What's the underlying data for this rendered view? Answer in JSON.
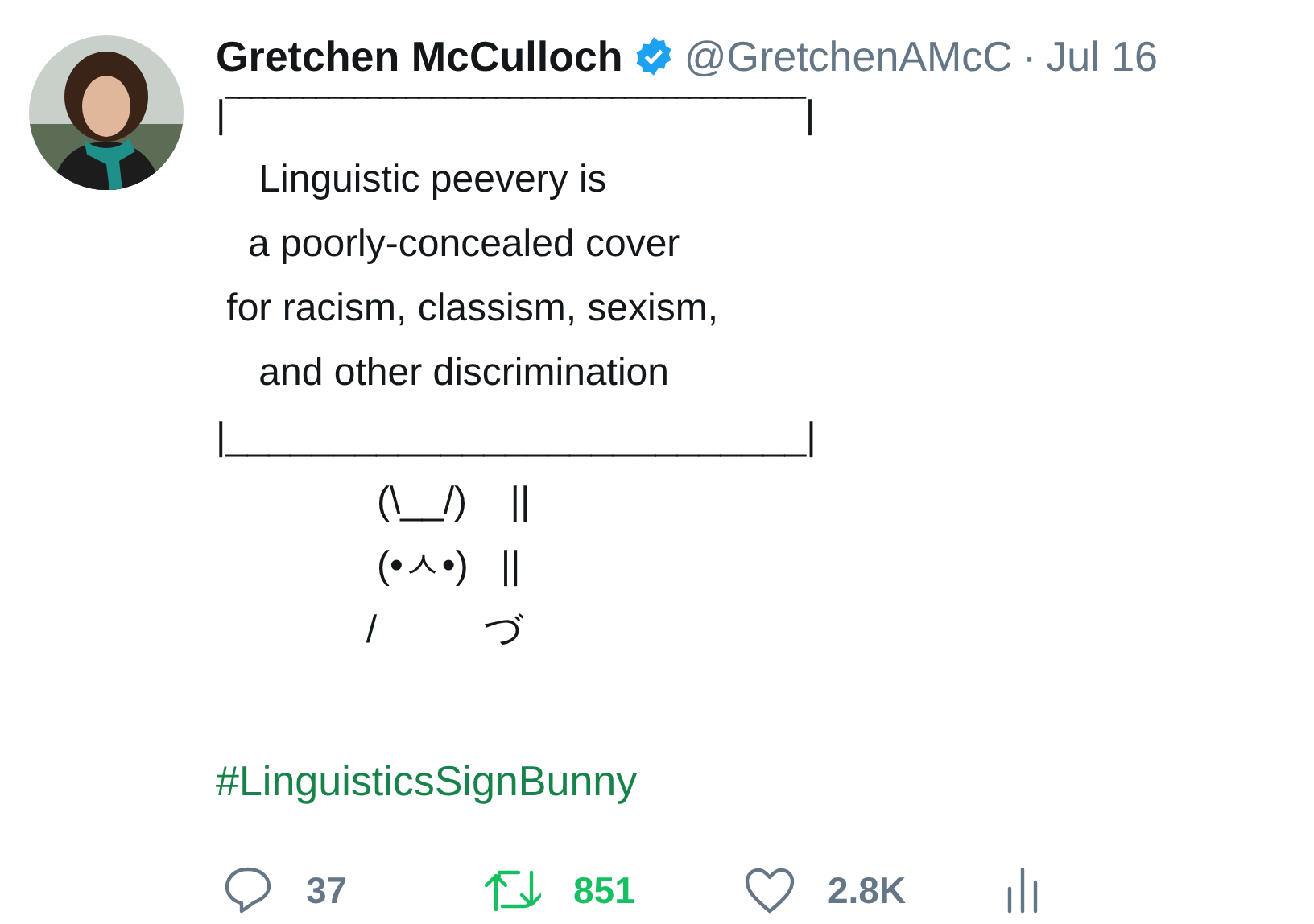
{
  "tweet": {
    "author": {
      "name": "Gretchen McCulloch",
      "verified": true,
      "handle": "@GretchenAMcC",
      "separator": "·",
      "date": "Jul 16"
    },
    "lines": [
      "|‾‾‾‾‾‾‾‾‾‾‾‾‾‾‾‾‾‾‾‾‾‾‾‾‾‾‾‾‾‾‾‾‾‾‾‾‾‾‾‾‾‾‾‾‾|",
      "    Linguistic peevery is",
      "   a poorly-concealed cover",
      " for racism, classism, sexism,",
      "    and other discrimination",
      "|___________________________|",
      "               (\\__/)    ||",
      "               (•ㅅ•)   ||",
      "              /          づ"
    ],
    "hashtag": "#LinguisticsSignBunny",
    "actions": [
      {
        "kind": "reply",
        "count": "37",
        "active": false
      },
      {
        "kind": "retweet",
        "count": "851",
        "active": true
      },
      {
        "kind": "like",
        "count": "2.8K",
        "active": false
      },
      {
        "kind": "analytics"
      }
    ]
  }
}
